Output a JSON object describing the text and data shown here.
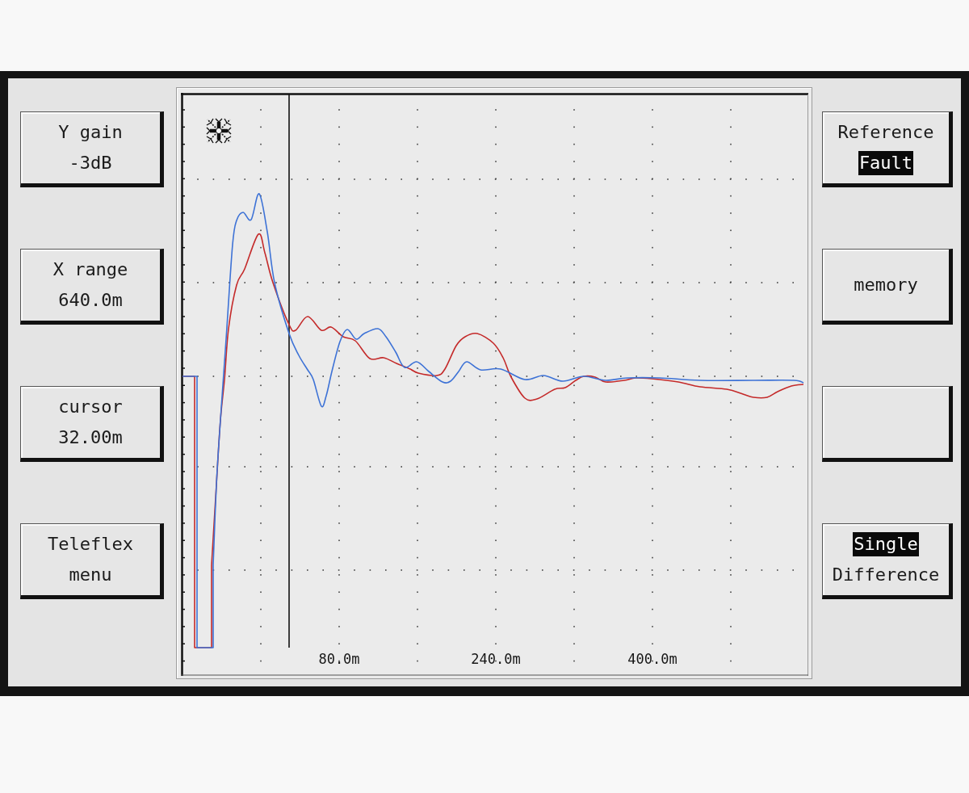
{
  "left_softkeys": [
    {
      "kind": "text",
      "lines": [
        "Y gain",
        "-3dB"
      ]
    },
    {
      "kind": "text",
      "lines": [
        "X range",
        "640.0m"
      ]
    },
    {
      "kind": "text",
      "lines": [
        "cursor",
        "32.00m"
      ]
    },
    {
      "kind": "text",
      "lines": [
        "Teleflex",
        "menu"
      ]
    }
  ],
  "graph": {
    "x_axis_labels": [
      "80.0m",
      "240.0m",
      "400.0m"
    ]
  },
  "right_softkeys": [
    {
      "kind": "toggle",
      "options": [
        {
          "text": "Reference",
          "selected": false
        },
        {
          "text": "Fault",
          "selected": true
        }
      ]
    },
    {
      "kind": "text",
      "lines": [
        "memory"
      ]
    },
    {
      "kind": "blank"
    },
    {
      "kind": "toggle",
      "options": [
        {
          "text": "Single",
          "selected": true
        },
        {
          "text": "Difference",
          "selected": false
        }
      ]
    }
  ]
}
